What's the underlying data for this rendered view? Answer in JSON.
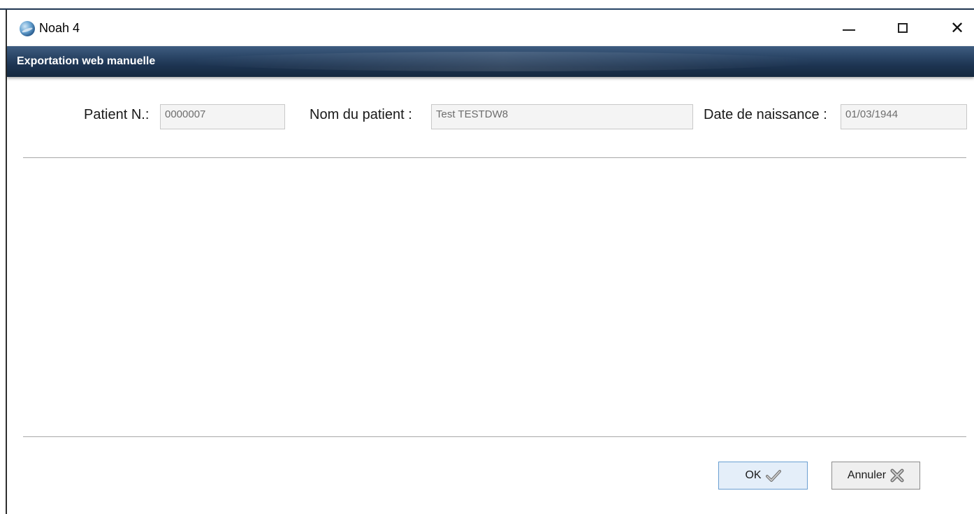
{
  "window": {
    "title": "Noah 4",
    "minimize_icon": "minimize-icon",
    "maximize_icon": "maximize-icon",
    "close_symbol": "✕"
  },
  "header": {
    "title": "Exportation web manuelle"
  },
  "form": {
    "patient_number_label": "Patient N.:",
    "patient_number_value": "0000007",
    "patient_name_label": "Nom du patient :",
    "patient_name_value": "Test TESTDW8",
    "birth_date_label": "Date de naissance :",
    "birth_date_value": "01/03/1944"
  },
  "footer": {
    "ok_label": "OK",
    "cancel_label": "Annuler"
  },
  "icons": {
    "app": "noah-app-icon",
    "ok": "checkmark-icon",
    "cancel": "x-cross-icon"
  },
  "colors": {
    "header_bar": "#1c3350",
    "ok_border": "#6a9fd1",
    "field_text": "#6d6d6d"
  }
}
